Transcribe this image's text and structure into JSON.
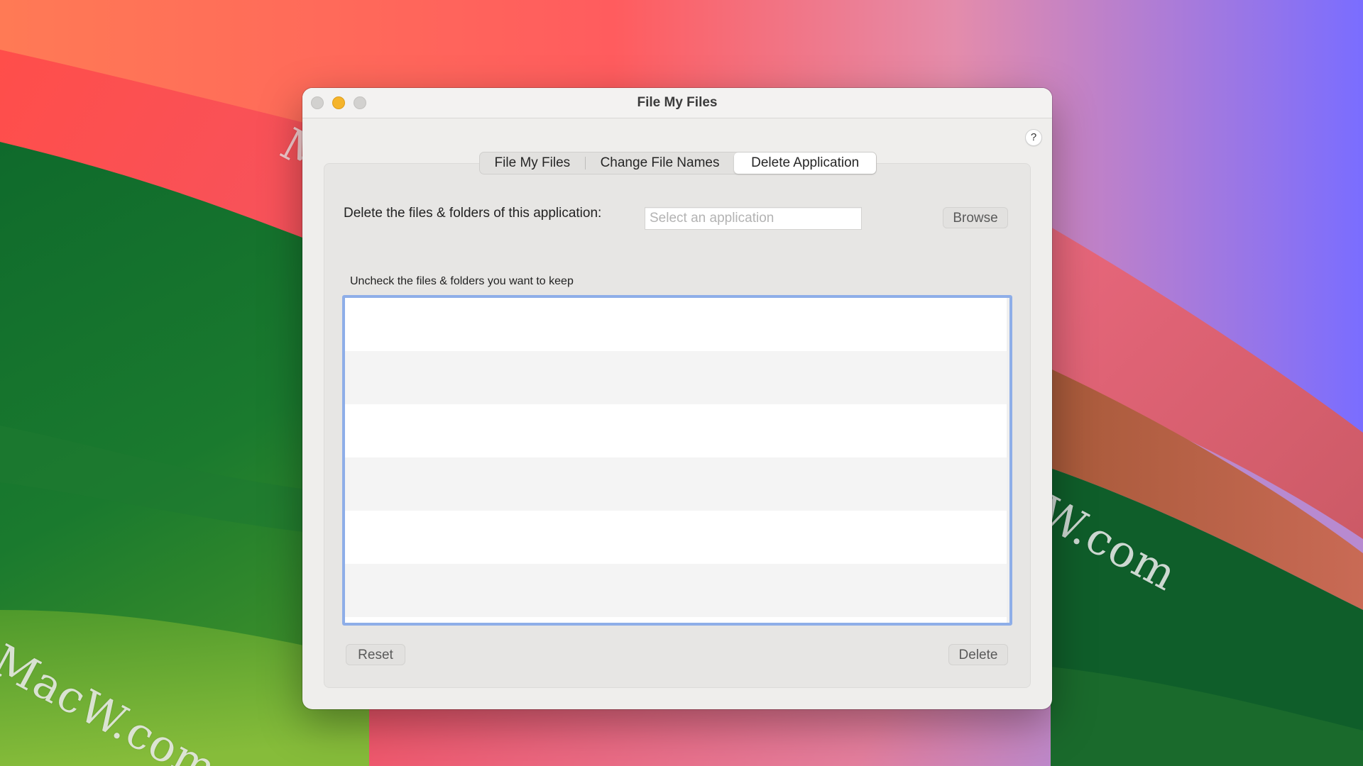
{
  "window": {
    "title": "File My Files"
  },
  "help": {
    "label": "?"
  },
  "tabs": [
    {
      "label": "File My Files",
      "selected": false
    },
    {
      "label": "Change File Names",
      "selected": false
    },
    {
      "label": "Delete Application",
      "selected": true
    }
  ],
  "delete_app": {
    "prompt_label": "Delete the files & folders of this application:",
    "input_value": "",
    "input_placeholder": "Select an application",
    "browse_label": "Browse",
    "list_label": "Uncheck the files & folders you want to keep",
    "reset_label": "Reset",
    "delete_label": "Delete"
  },
  "watermark": "MacW.com",
  "colors": {
    "list_focus_ring": "#8eaee8",
    "minimize_button": "#f5b42b"
  }
}
